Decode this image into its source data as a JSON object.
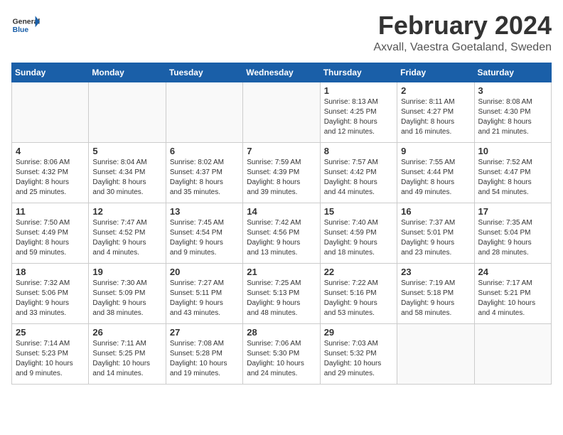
{
  "header": {
    "logo_general": "General",
    "logo_blue": "Blue",
    "month_title": "February 2024",
    "location": "Axvall, Vaestra Goetaland, Sweden"
  },
  "days_of_week": [
    "Sunday",
    "Monday",
    "Tuesday",
    "Wednesday",
    "Thursday",
    "Friday",
    "Saturday"
  ],
  "weeks": [
    [
      {
        "day": "",
        "info": ""
      },
      {
        "day": "",
        "info": ""
      },
      {
        "day": "",
        "info": ""
      },
      {
        "day": "",
        "info": ""
      },
      {
        "day": "1",
        "info": "Sunrise: 8:13 AM\nSunset: 4:25 PM\nDaylight: 8 hours\nand 12 minutes."
      },
      {
        "day": "2",
        "info": "Sunrise: 8:11 AM\nSunset: 4:27 PM\nDaylight: 8 hours\nand 16 minutes."
      },
      {
        "day": "3",
        "info": "Sunrise: 8:08 AM\nSunset: 4:30 PM\nDaylight: 8 hours\nand 21 minutes."
      }
    ],
    [
      {
        "day": "4",
        "info": "Sunrise: 8:06 AM\nSunset: 4:32 PM\nDaylight: 8 hours\nand 25 minutes."
      },
      {
        "day": "5",
        "info": "Sunrise: 8:04 AM\nSunset: 4:34 PM\nDaylight: 8 hours\nand 30 minutes."
      },
      {
        "day": "6",
        "info": "Sunrise: 8:02 AM\nSunset: 4:37 PM\nDaylight: 8 hours\nand 35 minutes."
      },
      {
        "day": "7",
        "info": "Sunrise: 7:59 AM\nSunset: 4:39 PM\nDaylight: 8 hours\nand 39 minutes."
      },
      {
        "day": "8",
        "info": "Sunrise: 7:57 AM\nSunset: 4:42 PM\nDaylight: 8 hours\nand 44 minutes."
      },
      {
        "day": "9",
        "info": "Sunrise: 7:55 AM\nSunset: 4:44 PM\nDaylight: 8 hours\nand 49 minutes."
      },
      {
        "day": "10",
        "info": "Sunrise: 7:52 AM\nSunset: 4:47 PM\nDaylight: 8 hours\nand 54 minutes."
      }
    ],
    [
      {
        "day": "11",
        "info": "Sunrise: 7:50 AM\nSunset: 4:49 PM\nDaylight: 8 hours\nand 59 minutes."
      },
      {
        "day": "12",
        "info": "Sunrise: 7:47 AM\nSunset: 4:52 PM\nDaylight: 9 hours\nand 4 minutes."
      },
      {
        "day": "13",
        "info": "Sunrise: 7:45 AM\nSunset: 4:54 PM\nDaylight: 9 hours\nand 9 minutes."
      },
      {
        "day": "14",
        "info": "Sunrise: 7:42 AM\nSunset: 4:56 PM\nDaylight: 9 hours\nand 13 minutes."
      },
      {
        "day": "15",
        "info": "Sunrise: 7:40 AM\nSunset: 4:59 PM\nDaylight: 9 hours\nand 18 minutes."
      },
      {
        "day": "16",
        "info": "Sunrise: 7:37 AM\nSunset: 5:01 PM\nDaylight: 9 hours\nand 23 minutes."
      },
      {
        "day": "17",
        "info": "Sunrise: 7:35 AM\nSunset: 5:04 PM\nDaylight: 9 hours\nand 28 minutes."
      }
    ],
    [
      {
        "day": "18",
        "info": "Sunrise: 7:32 AM\nSunset: 5:06 PM\nDaylight: 9 hours\nand 33 minutes."
      },
      {
        "day": "19",
        "info": "Sunrise: 7:30 AM\nSunset: 5:09 PM\nDaylight: 9 hours\nand 38 minutes."
      },
      {
        "day": "20",
        "info": "Sunrise: 7:27 AM\nSunset: 5:11 PM\nDaylight: 9 hours\nand 43 minutes."
      },
      {
        "day": "21",
        "info": "Sunrise: 7:25 AM\nSunset: 5:13 PM\nDaylight: 9 hours\nand 48 minutes."
      },
      {
        "day": "22",
        "info": "Sunrise: 7:22 AM\nSunset: 5:16 PM\nDaylight: 9 hours\nand 53 minutes."
      },
      {
        "day": "23",
        "info": "Sunrise: 7:19 AM\nSunset: 5:18 PM\nDaylight: 9 hours\nand 58 minutes."
      },
      {
        "day": "24",
        "info": "Sunrise: 7:17 AM\nSunset: 5:21 PM\nDaylight: 10 hours\nand 4 minutes."
      }
    ],
    [
      {
        "day": "25",
        "info": "Sunrise: 7:14 AM\nSunset: 5:23 PM\nDaylight: 10 hours\nand 9 minutes."
      },
      {
        "day": "26",
        "info": "Sunrise: 7:11 AM\nSunset: 5:25 PM\nDaylight: 10 hours\nand 14 minutes."
      },
      {
        "day": "27",
        "info": "Sunrise: 7:08 AM\nSunset: 5:28 PM\nDaylight: 10 hours\nand 19 minutes."
      },
      {
        "day": "28",
        "info": "Sunrise: 7:06 AM\nSunset: 5:30 PM\nDaylight: 10 hours\nand 24 minutes."
      },
      {
        "day": "29",
        "info": "Sunrise: 7:03 AM\nSunset: 5:32 PM\nDaylight: 10 hours\nand 29 minutes."
      },
      {
        "day": "",
        "info": ""
      },
      {
        "day": "",
        "info": ""
      }
    ]
  ]
}
